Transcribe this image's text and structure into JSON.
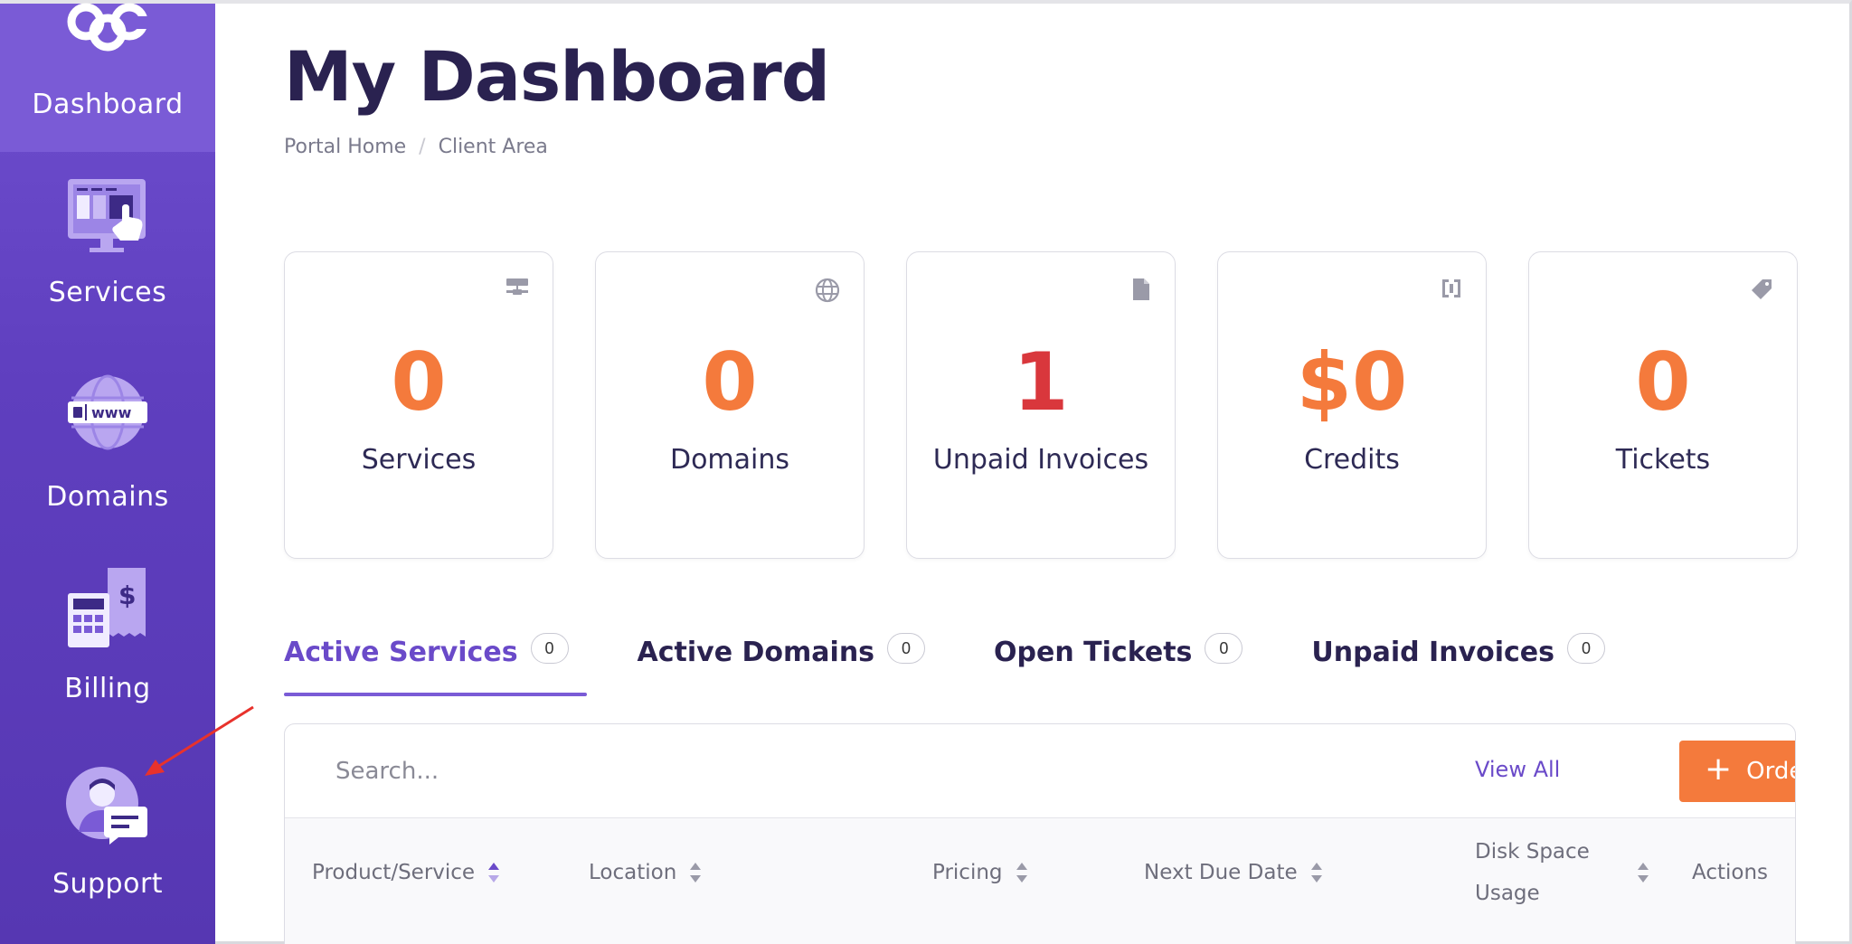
{
  "sidebar": {
    "items": [
      {
        "label": "Dashboard",
        "icon": "ccc-logo-icon",
        "active": true
      },
      {
        "label": "Services",
        "icon": "services-icon"
      },
      {
        "label": "Domains",
        "icon": "globe-www-icon"
      },
      {
        "label": "Billing",
        "icon": "calculator-invoice-icon"
      },
      {
        "label": "Support",
        "icon": "support-agent-icon"
      }
    ]
  },
  "header": {
    "title": "My Dashboard",
    "breadcrumb": [
      "Portal Home",
      "Client Area"
    ]
  },
  "stats": [
    {
      "value": "0",
      "label": "Services",
      "icon": "server-icon",
      "color": "#f47a3c"
    },
    {
      "value": "0",
      "label": "Domains",
      "icon": "globe-icon",
      "color": "#f47a3c"
    },
    {
      "value": "1",
      "label": "Unpaid Invoices",
      "icon": "document-icon",
      "color": "#d9373c"
    },
    {
      "value": "$0",
      "label": "Credits",
      "icon": "credit-bracket-icon",
      "color": "#f47a3c"
    },
    {
      "value": "0",
      "label": "Tickets",
      "icon": "tag-icon",
      "color": "#f47a3c"
    }
  ],
  "tabs": [
    {
      "label": "Active Services",
      "count": "0",
      "active": true
    },
    {
      "label": "Active Domains",
      "count": "0"
    },
    {
      "label": "Open Tickets",
      "count": "0"
    },
    {
      "label": "Unpaid Invoices",
      "count": "0"
    }
  ],
  "panel": {
    "search_placeholder": "Search...",
    "view_all": "View All",
    "order_label": "Order",
    "columns": [
      "Product/Service",
      "Location",
      "Pricing",
      "Next Due Date",
      "Disk Space",
      "Usage",
      "Actions"
    ]
  },
  "colors": {
    "accent": "#6a4ac9",
    "orange": "#f47a3c",
    "red": "#d9373c",
    "sidebar": "#5f3fbf"
  }
}
